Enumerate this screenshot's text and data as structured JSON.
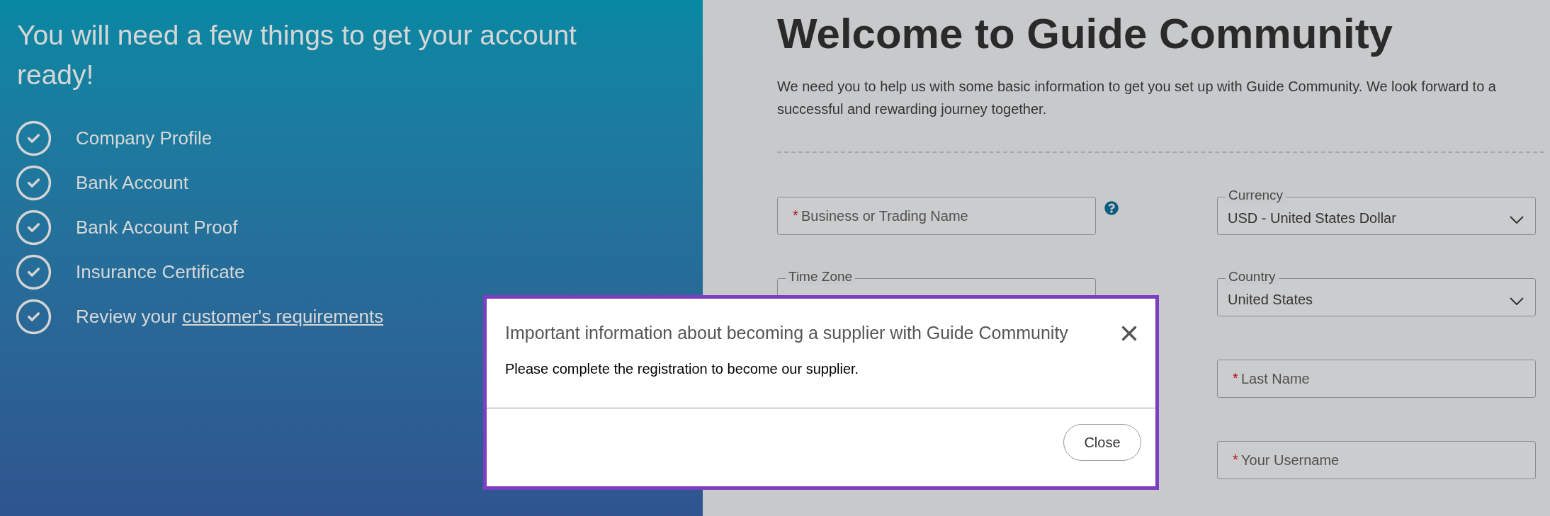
{
  "sidebar": {
    "heading": "You will need a few things to get your account ready!",
    "checklist": [
      {
        "label": "Company Profile",
        "checked": true
      },
      {
        "label": "Bank Account",
        "checked": true
      },
      {
        "label": "Bank Account Proof",
        "checked": true
      },
      {
        "label": "Insurance Certificate",
        "checked": true
      },
      {
        "label": "Review your",
        "link": "customer's requirements",
        "checked": true
      }
    ]
  },
  "main": {
    "title": "Welcome to Guide Community",
    "intro": "We need you to help us with some basic information to get you set up with Guide Community. We look forward to a successful and rewarding journey together.",
    "left_fields": [
      {
        "kind": "text",
        "mark": "*",
        "placeholder": "Business or Trading Name",
        "help": true
      },
      {
        "kind": "select",
        "label": "Time Zone"
      }
    ],
    "right_fields": [
      {
        "kind": "select",
        "label": "Currency",
        "value": "USD - United States Dollar"
      },
      {
        "kind": "select",
        "label": "Country",
        "value": "United States"
      },
      {
        "kind": "text",
        "mark": "*",
        "placeholder": "Last Name"
      },
      {
        "kind": "text",
        "mark": "*",
        "placeholder": "Your Username"
      }
    ]
  },
  "dialog": {
    "title": "Important information about becoming a supplier with Guide Community",
    "message": "Please complete the registration to become our supplier.",
    "button": "Close"
  }
}
